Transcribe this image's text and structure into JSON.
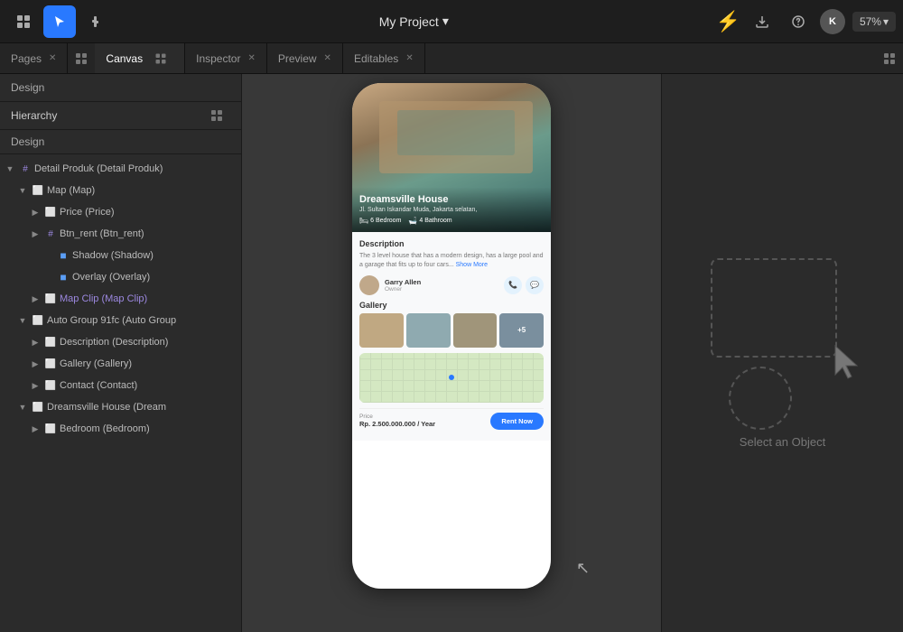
{
  "topbar": {
    "title": "My Project",
    "title_arrow": "▾",
    "zoom": "57%",
    "avatar": "K"
  },
  "tabs": [
    {
      "id": "pages",
      "label": "Pages",
      "active": false,
      "closable": true
    },
    {
      "id": "canvas",
      "label": "Canvas",
      "active": true,
      "closable": false
    },
    {
      "id": "inspector",
      "label": "Inspector",
      "active": false,
      "closable": true
    },
    {
      "id": "preview",
      "label": "Preview",
      "active": false,
      "closable": true
    },
    {
      "id": "editables",
      "label": "Editables",
      "active": false,
      "closable": true
    }
  ],
  "sidebar": {
    "design_label": "Design",
    "hierarchy_label": "Hierarchy",
    "second_design": "Design",
    "tree": [
      {
        "indent": 0,
        "arrow": "▼",
        "icon": "hash",
        "label": "Detail Produk (Detail Produk)",
        "color": "normal",
        "level": 0
      },
      {
        "indent": 1,
        "arrow": "▼",
        "icon": "frame",
        "label": "Map (Map)",
        "color": "normal",
        "level": 1
      },
      {
        "indent": 2,
        "arrow": "▶",
        "icon": "frame",
        "label": "Price (Price)",
        "color": "normal",
        "level": 2
      },
      {
        "indent": 2,
        "arrow": "▶",
        "icon": "hash",
        "label": "Btn_rent (Btn_rent)",
        "color": "normal",
        "level": 2
      },
      {
        "indent": 3,
        "arrow": "",
        "icon": "box",
        "label": "Shadow (Shadow)",
        "color": "normal",
        "level": 3
      },
      {
        "indent": 3,
        "arrow": "",
        "icon": "box",
        "label": "Overlay (Overlay)",
        "color": "normal",
        "level": 3
      },
      {
        "indent": 2,
        "arrow": "▶",
        "icon": "frame",
        "label": "Map Clip (Map Clip)",
        "color": "purple",
        "level": 2
      },
      {
        "indent": 1,
        "arrow": "▼",
        "icon": "frame",
        "label": "Auto Group 91fc (Auto Group",
        "color": "normal",
        "level": 1
      },
      {
        "indent": 2,
        "arrow": "▶",
        "icon": "frame",
        "label": "Description (Description)",
        "color": "normal",
        "level": 2
      },
      {
        "indent": 2,
        "arrow": "▶",
        "icon": "frame",
        "label": "Gallery (Gallery)",
        "color": "normal",
        "level": 2
      },
      {
        "indent": 2,
        "arrow": "▶",
        "icon": "frame",
        "label": "Contact (Contact)",
        "color": "normal",
        "level": 2
      },
      {
        "indent": 1,
        "arrow": "▼",
        "icon": "frame",
        "label": "Dreamsville House (Dream",
        "color": "normal",
        "level": 1
      },
      {
        "indent": 2,
        "arrow": "▶",
        "icon": "frame",
        "label": "Bedroom (Bedroom)",
        "color": "normal",
        "level": 2
      }
    ]
  },
  "canvas": {
    "phone": {
      "prop_title": "Dreamsville House",
      "prop_address": "Jl. Sultan Iskandar Muda, Jakarta selatan,",
      "bedrooms": "6 Bedroom",
      "bathrooms": "4 Bathroom",
      "desc_title": "Description",
      "desc_text": "The 3 level house that has a modern design, has a large pool and a garage that fits up to four cars...",
      "show_more": "Show More",
      "contact_name": "Garry Allen",
      "contact_role": "Owner",
      "gallery_title": "Gallery",
      "gallery_more": "+5",
      "price_label": "Price",
      "price_value": "Rp. 2.500.000.000 / Year",
      "rent_btn": "Rent Now"
    }
  },
  "inspector": {
    "select_label": "Select an Object"
  }
}
